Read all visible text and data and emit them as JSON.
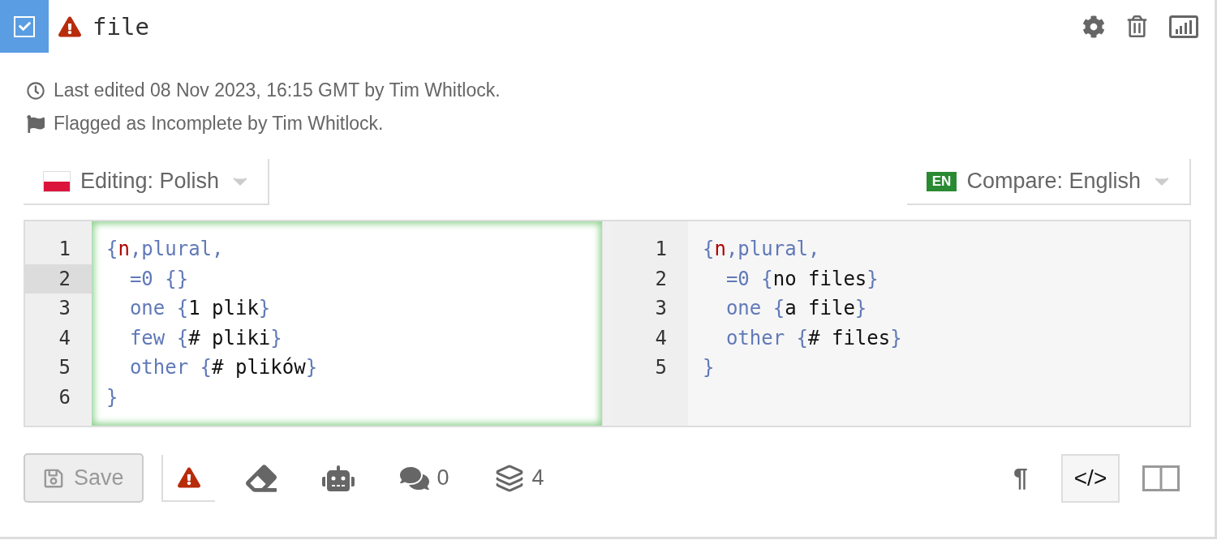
{
  "header": {
    "checked": true,
    "title": "file"
  },
  "meta": [
    {
      "kind": "clock",
      "text": "Last edited 08 Nov 2023, 16:15 GMT by Tim Whitlock."
    },
    {
      "kind": "flag",
      "text": "Flagged as Incomplete by Tim Whitlock."
    }
  ],
  "languages": {
    "editing": {
      "label": "Editing: Polish"
    },
    "compare": {
      "badge": "EN",
      "label": "Compare: English"
    }
  },
  "editors": [
    {
      "kind": "target",
      "lines": [
        {
          "number": "1",
          "active": false,
          "tokens": [
            {
              "kind": "punct",
              "text": "{"
            },
            {
              "kind": "var",
              "text": "n"
            },
            {
              "kind": "punct",
              "text": ",plural,"
            }
          ]
        },
        {
          "number": "2",
          "active": true,
          "tokens": [
            {
              "kind": "punct",
              "text": "  =0 {}"
            }
          ]
        },
        {
          "number": "3",
          "active": false,
          "tokens": [
            {
              "kind": "punct",
              "text": "  one {"
            },
            {
              "kind": "text",
              "text": "1 plik"
            },
            {
              "kind": "punct",
              "text": "}"
            }
          ]
        },
        {
          "number": "4",
          "active": false,
          "tokens": [
            {
              "kind": "punct",
              "text": "  few {"
            },
            {
              "kind": "text",
              "text": "# pliki"
            },
            {
              "kind": "punct",
              "text": "}"
            }
          ]
        },
        {
          "number": "5",
          "active": false,
          "tokens": [
            {
              "kind": "punct",
              "text": "  other {"
            },
            {
              "kind": "text",
              "text": "# plików"
            },
            {
              "kind": "punct",
              "text": "}"
            }
          ]
        },
        {
          "number": "6",
          "active": false,
          "tokens": [
            {
              "kind": "punct",
              "text": "}"
            }
          ]
        }
      ]
    },
    {
      "kind": "source",
      "lines": [
        {
          "number": "1",
          "active": false,
          "tokens": [
            {
              "kind": "punct",
              "text": "{"
            },
            {
              "kind": "var",
              "text": "n"
            },
            {
              "kind": "punct",
              "text": ",plural,"
            }
          ]
        },
        {
          "number": "2",
          "active": false,
          "tokens": [
            {
              "kind": "punct",
              "text": "  =0 {"
            },
            {
              "kind": "text",
              "text": "no files"
            },
            {
              "kind": "punct",
              "text": "}"
            }
          ]
        },
        {
          "number": "3",
          "active": false,
          "tokens": [
            {
              "kind": "punct",
              "text": "  one {"
            },
            {
              "kind": "text",
              "text": "a file"
            },
            {
              "kind": "punct",
              "text": "}"
            }
          ]
        },
        {
          "number": "4",
          "active": false,
          "tokens": [
            {
              "kind": "punct",
              "text": "  other {"
            },
            {
              "kind": "text",
              "text": "# files"
            },
            {
              "kind": "punct",
              "text": "}"
            }
          ]
        },
        {
          "number": "5",
          "active": false,
          "tokens": [
            {
              "kind": "punct",
              "text": "}"
            }
          ]
        }
      ]
    }
  ],
  "toolbar": {
    "save": {
      "label": "Save",
      "disabled": true
    },
    "tools": [
      {
        "kind": "warning",
        "selected": true
      },
      {
        "kind": "eraser",
        "selected": false
      },
      {
        "kind": "robot",
        "selected": false
      },
      {
        "kind": "comments",
        "count": "0",
        "selected": false
      },
      {
        "kind": "layers",
        "count": "4",
        "selected": false
      }
    ],
    "views": [
      {
        "kind": "pilcrow",
        "symbol": "¶",
        "selected": false
      },
      {
        "kind": "code",
        "symbol": "</>",
        "selected": true
      },
      {
        "kind": "split",
        "selected": false
      }
    ]
  }
}
